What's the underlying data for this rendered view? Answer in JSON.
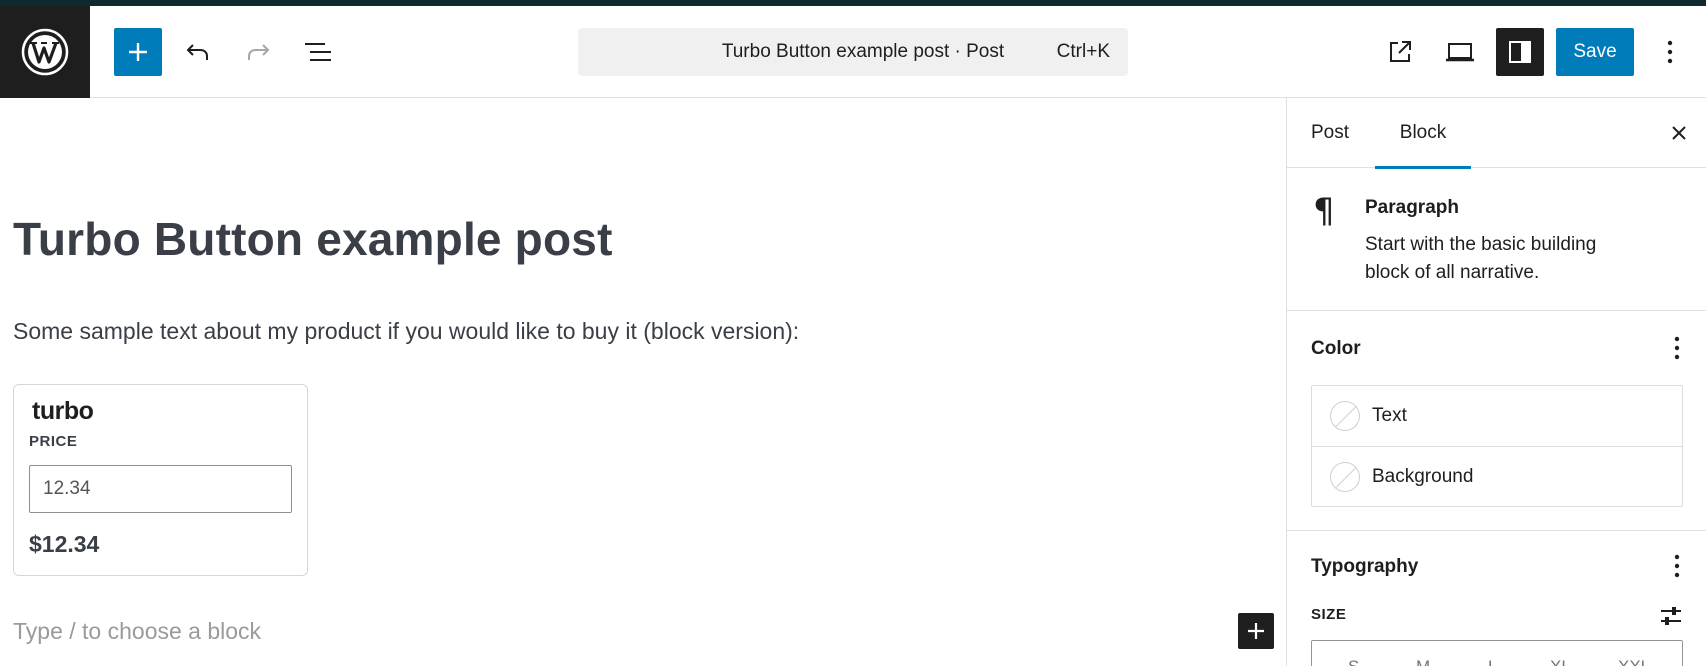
{
  "header": {
    "add_block_tooltip": "Add block",
    "command_bar": {
      "title": "Turbo Button example post · Post",
      "shortcut": "Ctrl+K"
    },
    "save_label": "Save",
    "icons": [
      "wordpress-logo-icon",
      "plus-icon",
      "undo-icon",
      "redo-icon",
      "list-view-icon",
      "external-link-icon",
      "desktop-icon",
      "sidebar-icon",
      "more-vertical-icon"
    ]
  },
  "editor": {
    "title": "Turbo Button example post",
    "paragraph": "Some sample text about my product if you would like to buy it (block version):",
    "turbo_block": {
      "logo": "turbo",
      "price_label": "PRICE",
      "price_value": "12.34",
      "display_price": "$12.34"
    },
    "appender_placeholder": "Type / to choose a block"
  },
  "sidebar": {
    "tabs": [
      {
        "label": "Post",
        "active": false
      },
      {
        "label": "Block",
        "active": true
      }
    ],
    "block_card": {
      "icon": "pilcrow",
      "name": "Paragraph",
      "description": "Start with the basic building block of all narrative."
    },
    "color_panel": {
      "title": "Color",
      "items": [
        {
          "label": "Text"
        },
        {
          "label": "Background"
        }
      ]
    },
    "typography_panel": {
      "title": "Typography",
      "size_label": "SIZE",
      "size_options": [
        "S",
        "M",
        "L",
        "XL",
        "XXL"
      ]
    }
  },
  "colors": {
    "accent": "#007cba",
    "dark": "#1e1e1e",
    "text": "#3a3f47"
  }
}
